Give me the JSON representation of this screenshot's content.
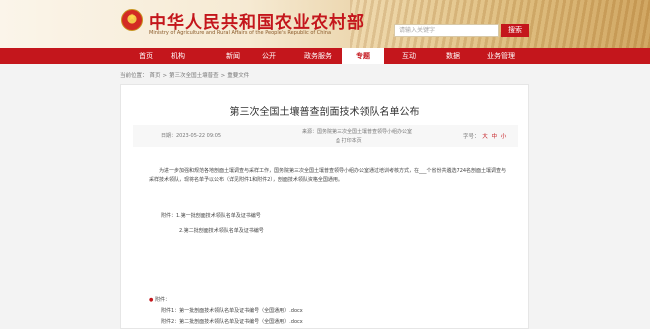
{
  "header": {
    "site_title": "中华人民共和国农业农村部",
    "site_subtitle": "Ministry of Agriculture and Rural Affairs of the People's Republic of China",
    "search_placeholder": "请输入关键字",
    "search_button": "搜索"
  },
  "nav": {
    "items": [
      {
        "label": "首页",
        "active": false
      },
      {
        "label": "机构",
        "active": false
      },
      {
        "label": "新闻",
        "active": false
      },
      {
        "label": "公开",
        "active": false
      },
      {
        "label": "政务服务",
        "active": false
      },
      {
        "label": "专题",
        "active": true
      },
      {
        "label": "互动",
        "active": false
      },
      {
        "label": "数据",
        "active": false
      },
      {
        "label": "业务管理",
        "active": false
      }
    ]
  },
  "breadcrumb": {
    "prefix": "当前位置：",
    "items": [
      "首页",
      ">",
      "第三次全国土壤普查",
      ">",
      "重要文件"
    ]
  },
  "article": {
    "title": "第三次全国土壤普查剖面技术领队名单公布",
    "date": "日期：2023-05-22 09:05",
    "source": "来源：国务院第三次全国土壤普查领导小组办公室",
    "print": "打印本页",
    "font_size_label": "字号：",
    "font_size_options": [
      "大",
      "中",
      "小"
    ],
    "paragraph": "为进一步加强和规范各地剖面土壤调查与采样工作，国务院第三次全国土壤普查领导小组办公室通过培训考核方式，在___个省份共遴选724名剖面土壤调查与采样技术领队，现将名单予以公布（详见附件1和附件2），剖面技术领队资格全国通用。",
    "attachments_inline": [
      "附件：1.第一批剖面技术领队名单及证书编号",
      "2.第二批剖面技术领队名单及证书编号"
    ],
    "attachments_label": "附件：",
    "attachment_files": [
      "附件1：第一批剖面技术领队名单及证书编号（全国通用）.docx",
      "附件2：第二批剖面技术领队名单及证书编号（全国通用）.docx"
    ]
  }
}
